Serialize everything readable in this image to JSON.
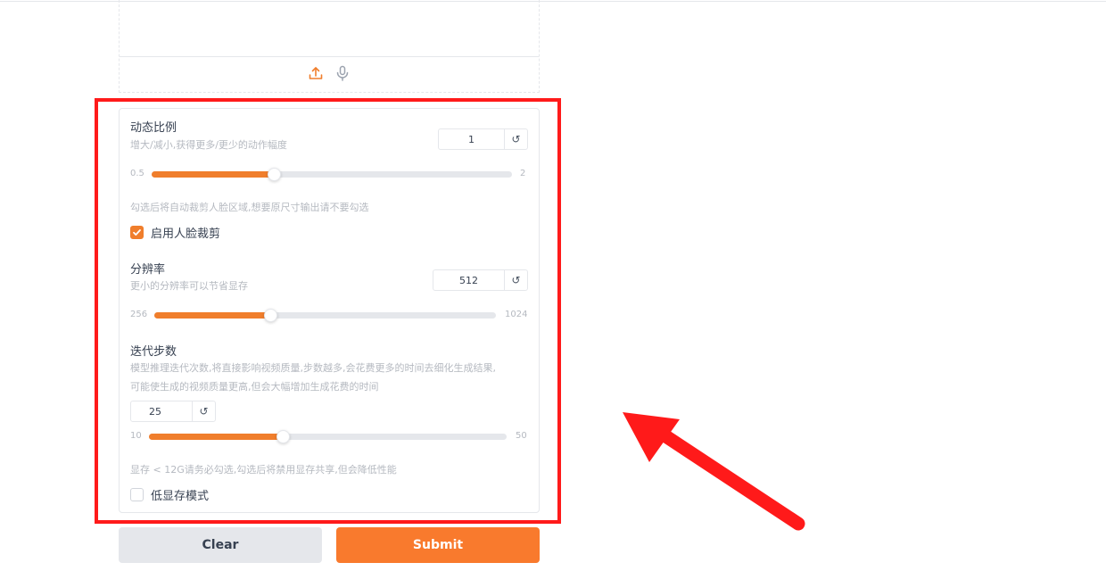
{
  "theme": {
    "accent": "#f07e2c",
    "submit_bg": "#f97a2d",
    "highlight": "#ff1a1a"
  },
  "upload": {
    "icons": [
      "upload-icon",
      "microphone-icon"
    ]
  },
  "motion_scale": {
    "label": "动态比例",
    "description": "增大/减小,获得更多/更少的动作幅度",
    "value": "1",
    "min": "0.5",
    "max": "2",
    "fraction": 0.34,
    "reset_icon": "↺"
  },
  "face_crop": {
    "hint": "勾选后将自动裁剪人脸区域,想要原尺寸输出请不要勾选",
    "label": "启用人脸裁剪",
    "checked": true
  },
  "resolution": {
    "label": "分辨率",
    "description": "更小的分辨率可以节省显存",
    "value": "512",
    "min": "256",
    "max": "1024",
    "fraction": 0.34,
    "reset_icon": "↺"
  },
  "steps": {
    "label": "迭代步数",
    "description_line1": "模型推理迭代次数,将直接影响视频质量,步数越多,会花费更多的时间去细化生成结果,",
    "description_line2": "可能使生成的视频质量更高,但会大幅增加生成花费的时间",
    "value": "25",
    "min": "10",
    "max": "50",
    "fraction": 0.375,
    "reset_icon": "↺"
  },
  "low_vram": {
    "hint": "显存 < 12G请务必勾选,勾选后将禁用显存共享,但会降低性能",
    "label": "低显存模式",
    "checked": false
  },
  "buttons": {
    "clear": "Clear",
    "submit": "Submit"
  }
}
